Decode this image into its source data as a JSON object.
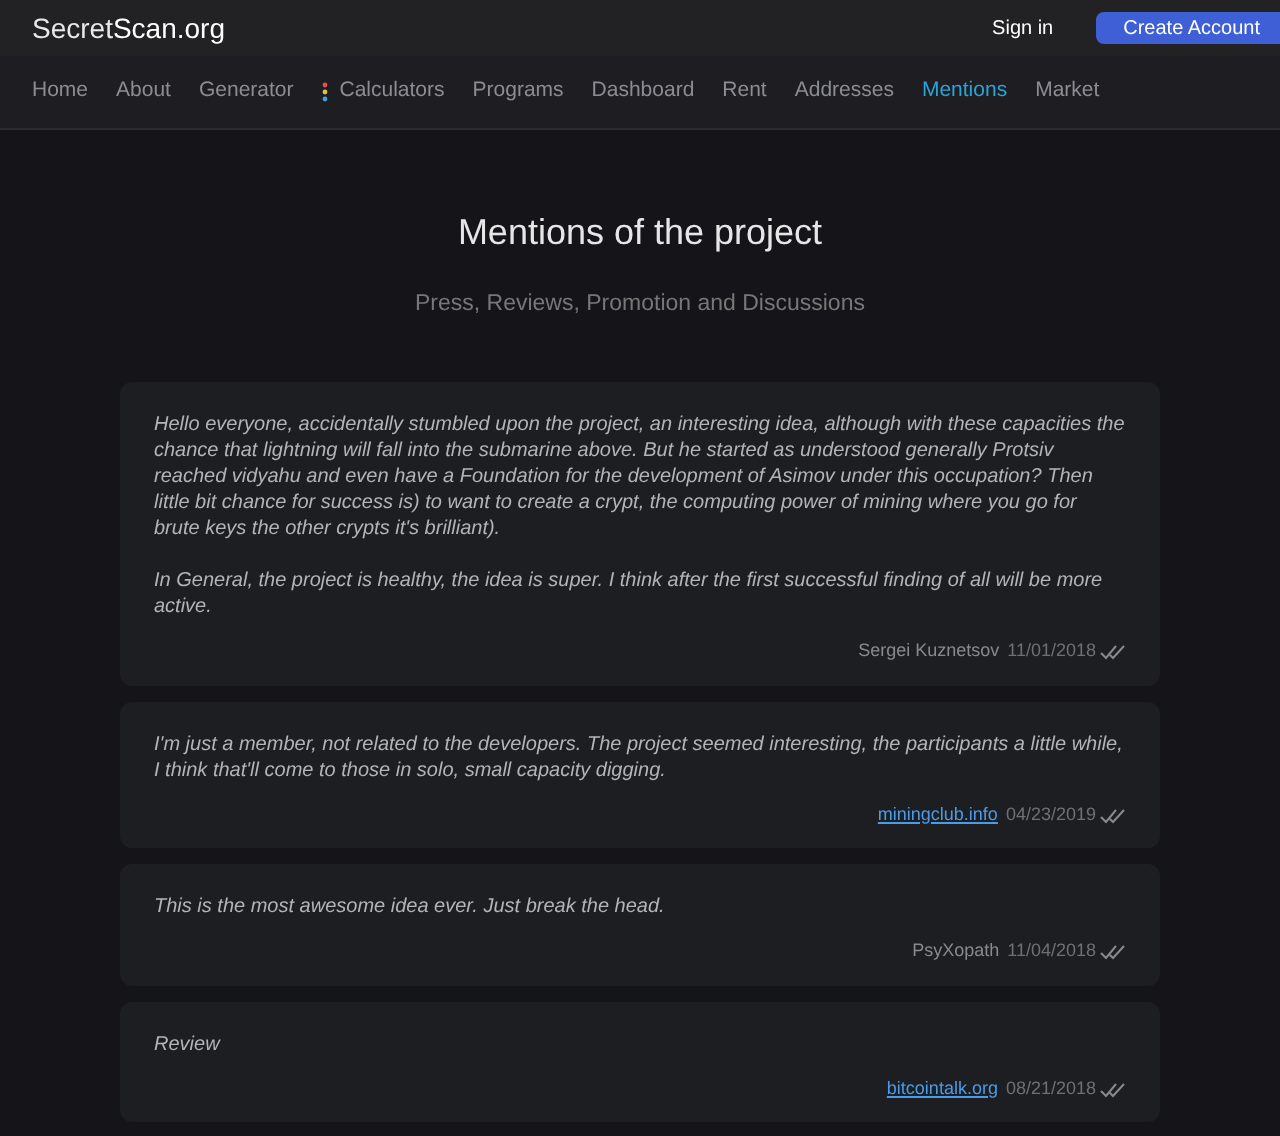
{
  "header": {
    "logo_prefix": "Secret",
    "logo_suffix": "Scan.org",
    "sign_in": "Sign in",
    "create_account": "Create Account"
  },
  "nav": [
    {
      "label": "Home",
      "selected": false
    },
    {
      "label": "About",
      "selected": false
    },
    {
      "label": "Generator",
      "selected": false
    },
    {
      "label": "Calculators",
      "selected": false,
      "kind": "icon"
    },
    {
      "label": "Programs",
      "selected": false
    },
    {
      "label": "Dashboard",
      "selected": false
    },
    {
      "label": "Rent",
      "selected": false
    },
    {
      "label": "Addresses",
      "selected": false
    },
    {
      "label": "Mentions",
      "selected": true
    },
    {
      "label": "Market",
      "selected": false
    }
  ],
  "title": "Mentions of the project",
  "subtitle": "Press, Reviews, Promotion and Discussions",
  "mentions": [
    {
      "paragraphs": [
        "Hello everyone, accidentally stumbled upon the project, an interesting idea, although with these capacities the chance that lightning will fall into the submarine above. But he started as understood generally Protsiv reached vidyahu and even have a Foundation for the development of Asimov under this occupation? Then little bit chance for success is) to want to create a crypt, the computing power of mining where you go for brute keys the other crypts it's brilliant).",
        "In General, the project is healthy, the idea is super. I think after the first successful finding of all will be more active."
      ],
      "source": "Sergei Kuznetsov",
      "kind": "name",
      "date": "11/01/2018"
    },
    {
      "paragraphs": [
        "I'm just a member, not related to the developers. The project seemed interesting, the participants a little while, I think that'll come to those in solo, small capacity digging."
      ],
      "source": "miningclub.info",
      "kind": "link",
      "date": "04/23/2019"
    },
    {
      "paragraphs": [
        "This is the most awesome idea ever. Just break the head."
      ],
      "source": "PsyXopath",
      "kind": "name",
      "date": "11/04/2018"
    },
    {
      "paragraphs": [
        "Review"
      ],
      "source": "bitcointalk.org",
      "kind": "link",
      "date": "08/21/2018"
    }
  ]
}
